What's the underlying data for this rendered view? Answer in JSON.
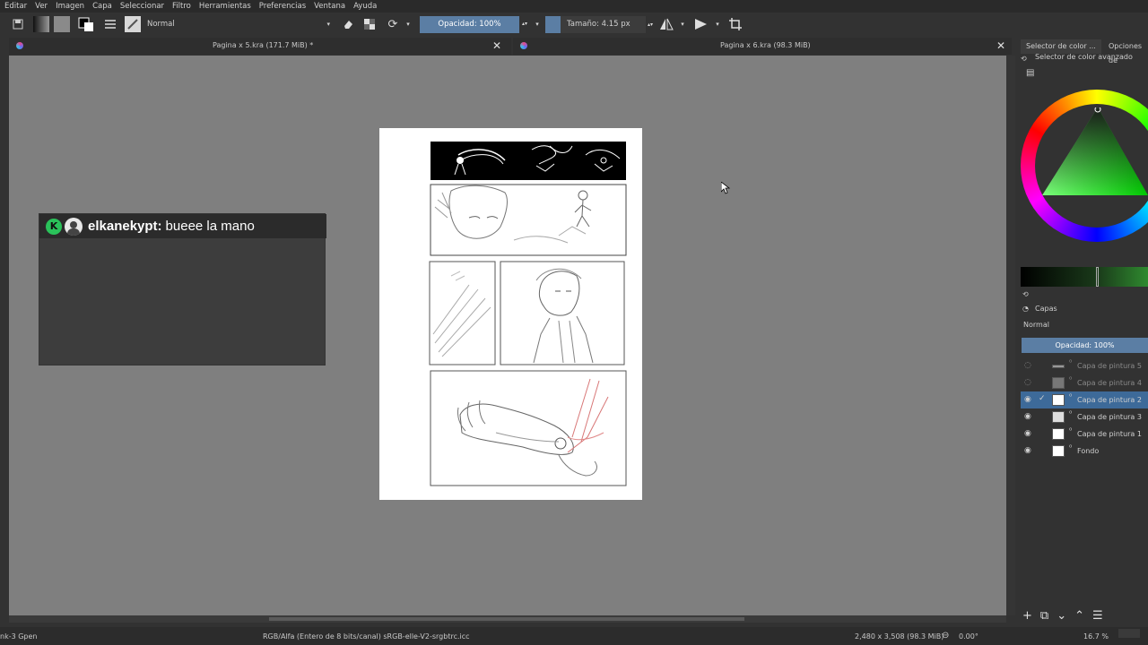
{
  "menu": [
    "Editar",
    "Ver",
    "Imagen",
    "Capa",
    "Seleccionar",
    "Filtro",
    "Herramientas",
    "Preferencias",
    "Ventana",
    "Ayuda"
  ],
  "toolbar": {
    "blend_mode": "Normal",
    "opacity_label": "Opacidad: 100%",
    "size_label": "Tamaño: 4.15 px"
  },
  "tabs": [
    {
      "title": "Pagina x 5.kra (171.7 MiB) *"
    },
    {
      "title": "Pagina x 6.kra (98.3 MiB)"
    }
  ],
  "chat": {
    "username": "elkanekypt:",
    "message": "bueee la mano"
  },
  "dock": {
    "tabs": [
      "Selector de color ...",
      "Opciones de"
    ],
    "color_panel_title": "Selector de color avanzado",
    "layers_title": "Capas",
    "layers_blend": "Normal",
    "layers_opacity": "Opacidad:  100%",
    "layers": [
      {
        "name": "Capa de pintura 5",
        "visible": false
      },
      {
        "name": "Capa de pintura 4",
        "visible": false
      },
      {
        "name": "Capa de pintura 2",
        "visible": true,
        "selected": true
      },
      {
        "name": "Capa de pintura 3",
        "visible": true
      },
      {
        "name": "Capa de pintura 1",
        "visible": true
      },
      {
        "name": "Fondo",
        "visible": true
      }
    ]
  },
  "status": {
    "brush": "nk-3 Gpen",
    "color_space": "RGB/Alfa (Entero de 8 bits/canal)  sRGB-elle-V2-srgbtrc.icc",
    "dimensions": "2,480 x 3,508 (98.3 MiB)",
    "rotation": "0.00°",
    "zoom": "16.7 %"
  }
}
